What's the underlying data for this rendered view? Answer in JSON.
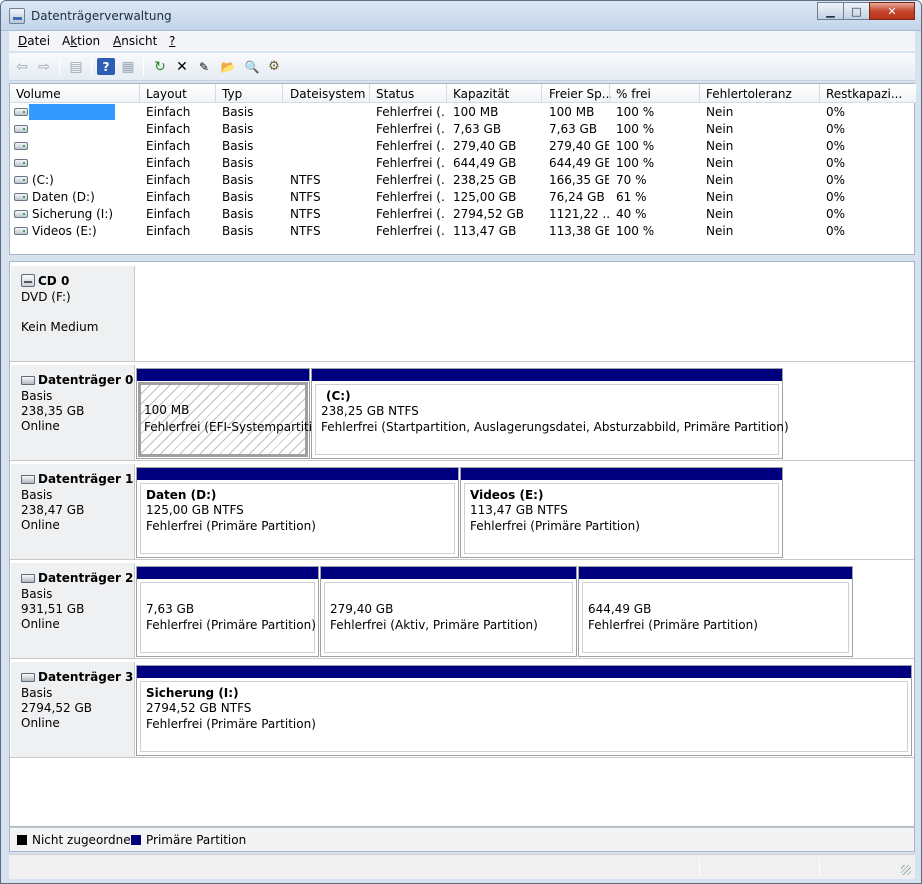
{
  "window": {
    "title": "Datenträgerverwaltung",
    "min": "▁",
    "max": "□",
    "close": "✕"
  },
  "menu": [
    {
      "label": "Datei",
      "ul": "D",
      "rest": "atei"
    },
    {
      "label": "Aktion",
      "ul": "k",
      "pre": "A",
      "rest": "tion"
    },
    {
      "label": "Ansicht",
      "ul": "A",
      "rest": "nsicht"
    },
    {
      "label": "?",
      "ul": "?",
      "rest": ""
    }
  ],
  "toolbar": {
    "back": "⇦",
    "forward": "⇨",
    "console": "▤",
    "help": "?",
    "props": "▦",
    "refresh": "↻",
    "delete": "✕",
    "wizard": "✎",
    "open": "📂",
    "search": "🔍",
    "settings": "⚙"
  },
  "columns": [
    "Volume",
    "Layout",
    "Typ",
    "Dateisystem",
    "Status",
    "Kapazität",
    "Freier Sp...",
    "% frei",
    "Fehlertoleranz",
    "Restkapazi..."
  ],
  "volumes": [
    {
      "name": "",
      "layout": "Einfach",
      "typ": "Basis",
      "fs": "",
      "status": "Fehlerfrei (...",
      "cap": "100 MB",
      "free": "100 MB",
      "pct": "100 %",
      "ft": "Nein",
      "rest": "0%"
    },
    {
      "name": "",
      "layout": "Einfach",
      "typ": "Basis",
      "fs": "",
      "status": "Fehlerfrei (...",
      "cap": "7,63 GB",
      "free": "7,63 GB",
      "pct": "100 %",
      "ft": "Nein",
      "rest": "0%"
    },
    {
      "name": "",
      "layout": "Einfach",
      "typ": "Basis",
      "fs": "",
      "status": "Fehlerfrei (...",
      "cap": "279,40 GB",
      "free": "279,40 GB",
      "pct": "100 %",
      "ft": "Nein",
      "rest": "0%"
    },
    {
      "name": "",
      "layout": "Einfach",
      "typ": "Basis",
      "fs": "",
      "status": "Fehlerfrei (...",
      "cap": "644,49 GB",
      "free": "644,49 GB",
      "pct": "100 %",
      "ft": "Nein",
      "rest": "0%"
    },
    {
      "name": "(C:)",
      "layout": "Einfach",
      "typ": "Basis",
      "fs": "NTFS",
      "status": "Fehlerfrei (...",
      "cap": "238,25 GB",
      "free": "166,35 GB",
      "pct": "70 %",
      "ft": "Nein",
      "rest": "0%"
    },
    {
      "name": "Daten (D:)",
      "layout": "Einfach",
      "typ": "Basis",
      "fs": "NTFS",
      "status": "Fehlerfrei (...",
      "cap": "125,00 GB",
      "free": "76,24 GB",
      "pct": "61 %",
      "ft": "Nein",
      "rest": "0%"
    },
    {
      "name": "Sicherung (I:)",
      "layout": "Einfach",
      "typ": "Basis",
      "fs": "NTFS",
      "status": "Fehlerfrei (...",
      "cap": "2794,52 GB",
      "free": "1121,22 ...",
      "pct": "40 %",
      "ft": "Nein",
      "rest": "0%"
    },
    {
      "name": "Videos (E:)",
      "layout": "Einfach",
      "typ": "Basis",
      "fs": "NTFS",
      "status": "Fehlerfrei (...",
      "cap": "113,47 GB",
      "free": "113,38 GB",
      "pct": "100 %",
      "ft": "Nein",
      "rest": "0%"
    }
  ],
  "cd": {
    "name": "CD 0",
    "drive": "DVD (F:)",
    "media": "Kein Medium"
  },
  "disks": [
    {
      "name": "Datenträger 0",
      "type": "Basis",
      "size": "238,35 GB",
      "state": "Online",
      "parts": [
        {
          "title": "",
          "size": "100 MB",
          "status": "Fehlerfrei (EFI-Systempartition)"
        },
        {
          "title": "(C:)",
          "size": "238,25 GB NTFS",
          "status": "Fehlerfrei (Startpartition, Auslagerungsdatei, Absturzabbild, Primäre Partition)"
        }
      ]
    },
    {
      "name": "Datenträger 1",
      "type": "Basis",
      "size": "238,47 GB",
      "state": "Online",
      "parts": [
        {
          "title": "Daten  (D:)",
          "size": "125,00 GB NTFS",
          "status": "Fehlerfrei (Primäre Partition)"
        },
        {
          "title": "Videos  (E:)",
          "size": "113,47 GB NTFS",
          "status": "Fehlerfrei (Primäre Partition)"
        }
      ]
    },
    {
      "name": "Datenträger 2",
      "type": "Basis",
      "size": "931,51 GB",
      "state": "Online",
      "parts": [
        {
          "title": "",
          "size": "7,63 GB",
          "status": "Fehlerfrei (Primäre Partition)"
        },
        {
          "title": "",
          "size": "279,40 GB",
          "status": "Fehlerfrei (Aktiv, Primäre Partition)"
        },
        {
          "title": "",
          "size": "644,49 GB",
          "status": "Fehlerfrei (Primäre Partition)"
        }
      ]
    },
    {
      "name": "Datenträger 3",
      "type": "Basis",
      "size": "2794,52 GB",
      "state": "Online",
      "parts": [
        {
          "title": "Sicherung  (I:)",
          "size": "2794,52 GB NTFS",
          "status": "Fehlerfrei (Primäre Partition)"
        }
      ]
    }
  ],
  "legend": {
    "unallocated": "Nicht zugeordnet",
    "primary": "Primäre Partition",
    "unallocated_color": "#000000",
    "primary_color": "#00007e"
  }
}
